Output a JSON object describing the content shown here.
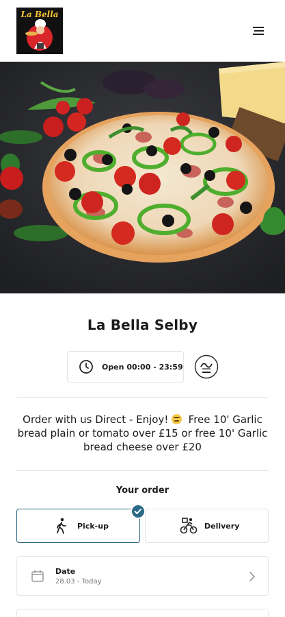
{
  "header": {
    "logo_text": "La Bella"
  },
  "restaurant": {
    "name": "La Bella Selby",
    "hours": "Open 00:00 - 23:59",
    "halal_icon": "halal-icon"
  },
  "promo": {
    "text_before": "Order with us Direct - Enjoy!",
    "text_after": "Free 10' Garlic bread plain or tomato over £15 or free 10' Garlic bread cheese over £20"
  },
  "order": {
    "heading": "Your order",
    "pickup_label": "Pick-up",
    "delivery_label": "Delivery",
    "selected": "Pick-up",
    "date_label": "Date",
    "date_value": "28.03 - Today"
  },
  "colors": {
    "accent": "#2b6a86",
    "hero_bg": "#2b2c30",
    "logo_text": "#f3c232"
  }
}
